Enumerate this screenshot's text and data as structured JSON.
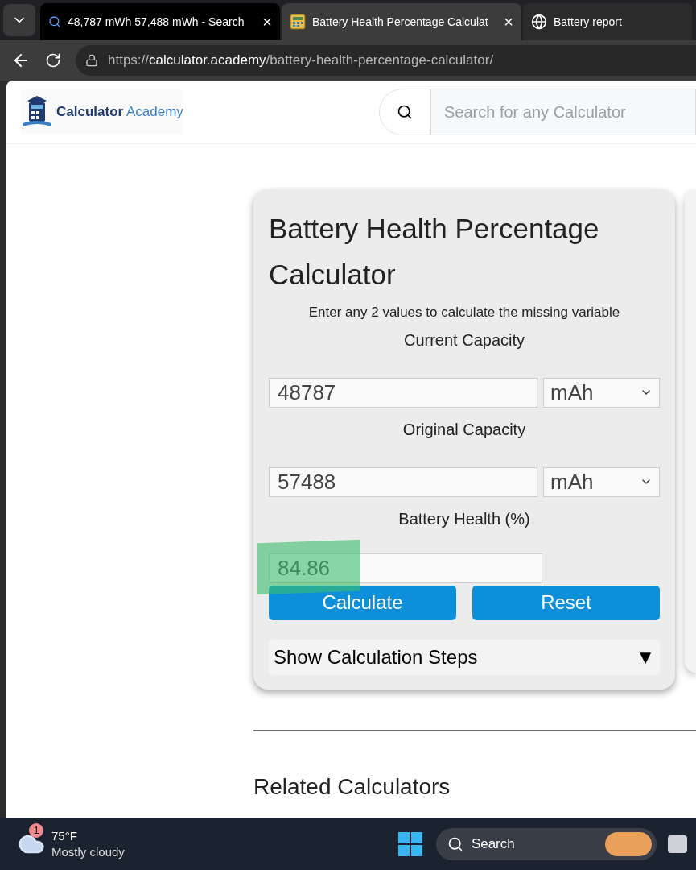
{
  "browser": {
    "tabs": [
      {
        "title": "48,787 mWh 57,488 mWh - Search",
        "kind": "search",
        "selected": false,
        "close": "×"
      },
      {
        "title": "Battery Health Percentage Calculat",
        "kind": "calculator",
        "selected": true,
        "close": "×"
      },
      {
        "title": "Battery report",
        "kind": "globe",
        "selected": false
      }
    ],
    "address": {
      "scheme": "https://",
      "host": "calculator.academy",
      "path": "/battery-health-percentage-calculator/"
    }
  },
  "site": {
    "logo": {
      "bold": "Calculator",
      "light": "Academy"
    },
    "search": {
      "placeholder": "Search for any Calculator"
    }
  },
  "calculator": {
    "title": "Battery Health Percentage Calculator",
    "subtitle": "Enter any 2 values to calculate the missing variable",
    "fields": [
      {
        "label": "Current Capacity",
        "value": "48787",
        "unit": "mAh",
        "kind": "unit"
      },
      {
        "label": "Original Capacity",
        "value": "57488",
        "unit": "mAh",
        "kind": "unit"
      },
      {
        "label": "Battery Health (%)",
        "value": "84.86",
        "kind": "plain",
        "highlighted": true
      }
    ],
    "buttons": [
      "Calculate",
      "Reset"
    ],
    "steps": {
      "label": "Show Calculation Steps",
      "toggle": "▼",
      "expanded": false
    }
  },
  "related": {
    "title": "Related Calculators"
  },
  "taskbar": {
    "weather": {
      "badge": "1",
      "temp": "75°F",
      "condition": "Mostly cloudy"
    },
    "search": "Search"
  }
}
